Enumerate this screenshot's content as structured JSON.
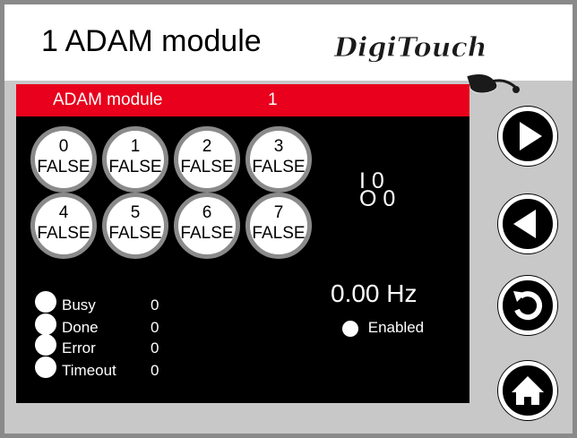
{
  "header": {
    "title": "1 ADAM module",
    "logo_text": "DigiTouch"
  },
  "panel": {
    "title": "ADAM module",
    "module_number": "1",
    "channels": [
      {
        "index": "0",
        "value": "FALSE"
      },
      {
        "index": "1",
        "value": "FALSE"
      },
      {
        "index": "2",
        "value": "FALSE"
      },
      {
        "index": "3",
        "value": "FALSE"
      },
      {
        "index": "4",
        "value": "FALSE"
      },
      {
        "index": "5",
        "value": "FALSE"
      },
      {
        "index": "6",
        "value": "FALSE"
      },
      {
        "index": "7",
        "value": "FALSE"
      }
    ],
    "input_readout": "I 0",
    "output_readout": "O 0",
    "frequency": "0.00 Hz",
    "enabled_label": "Enabled",
    "status": [
      {
        "label": "Busy",
        "value": "0"
      },
      {
        "label": "Done",
        "value": "0"
      },
      {
        "label": "Error",
        "value": "0"
      },
      {
        "label": "Timeout",
        "value": "0"
      }
    ]
  },
  "nav": {
    "buttons": [
      "play-forward-icon",
      "play-back-icon",
      "undo-icon",
      "home-icon"
    ]
  },
  "colors": {
    "panel_header": "#e8001c",
    "panel_bg": "#000000",
    "frame_bg": "#c8c8c8",
    "channel_ring": "#8a8a8a"
  }
}
